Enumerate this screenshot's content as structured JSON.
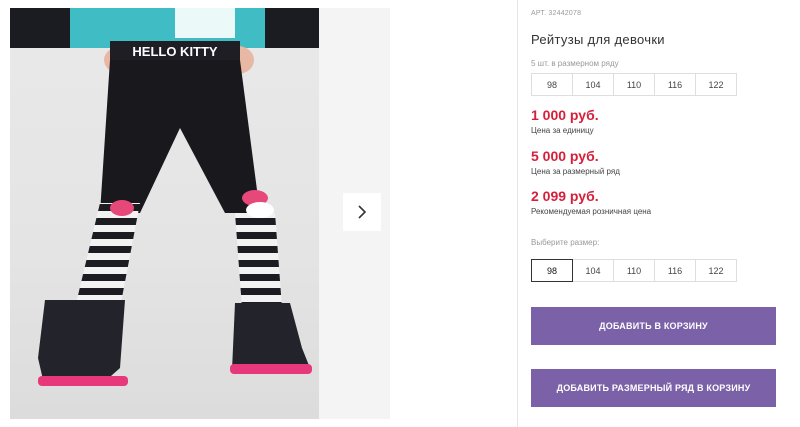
{
  "product": {
    "article": "АРТ. 32442078",
    "title": "Рейтузы для девочки",
    "size_series_note": "5 шт. в размерном ряду",
    "size_series": [
      "98",
      "104",
      "110",
      "116",
      "122"
    ],
    "prices": [
      {
        "value": "1 000 руб.",
        "caption": "Цена за единицу"
      },
      {
        "value": "5 000 руб.",
        "caption": "Цена за размерный ряд"
      },
      {
        "value": "2 099 руб.",
        "caption": "Рекомендуемая розничная цена"
      }
    ],
    "choose_size_label": "Выберите размер:",
    "size_options": [
      "98",
      "104",
      "110",
      "116",
      "122"
    ],
    "selected_size": "98"
  },
  "photo": {
    "shirt_text": "HELLO KITTY"
  },
  "buttons": {
    "add_to_cart": "ДОБАВИТЬ В КОРЗИНУ",
    "add_series_to_cart": "ДОБАВИТЬ РАЗМЕРНЫЙ РЯД В КОРЗИНУ"
  },
  "colors": {
    "accent": "#7b62a8",
    "price": "#d6203b"
  },
  "icons": {
    "next": "chevron-right-icon"
  }
}
